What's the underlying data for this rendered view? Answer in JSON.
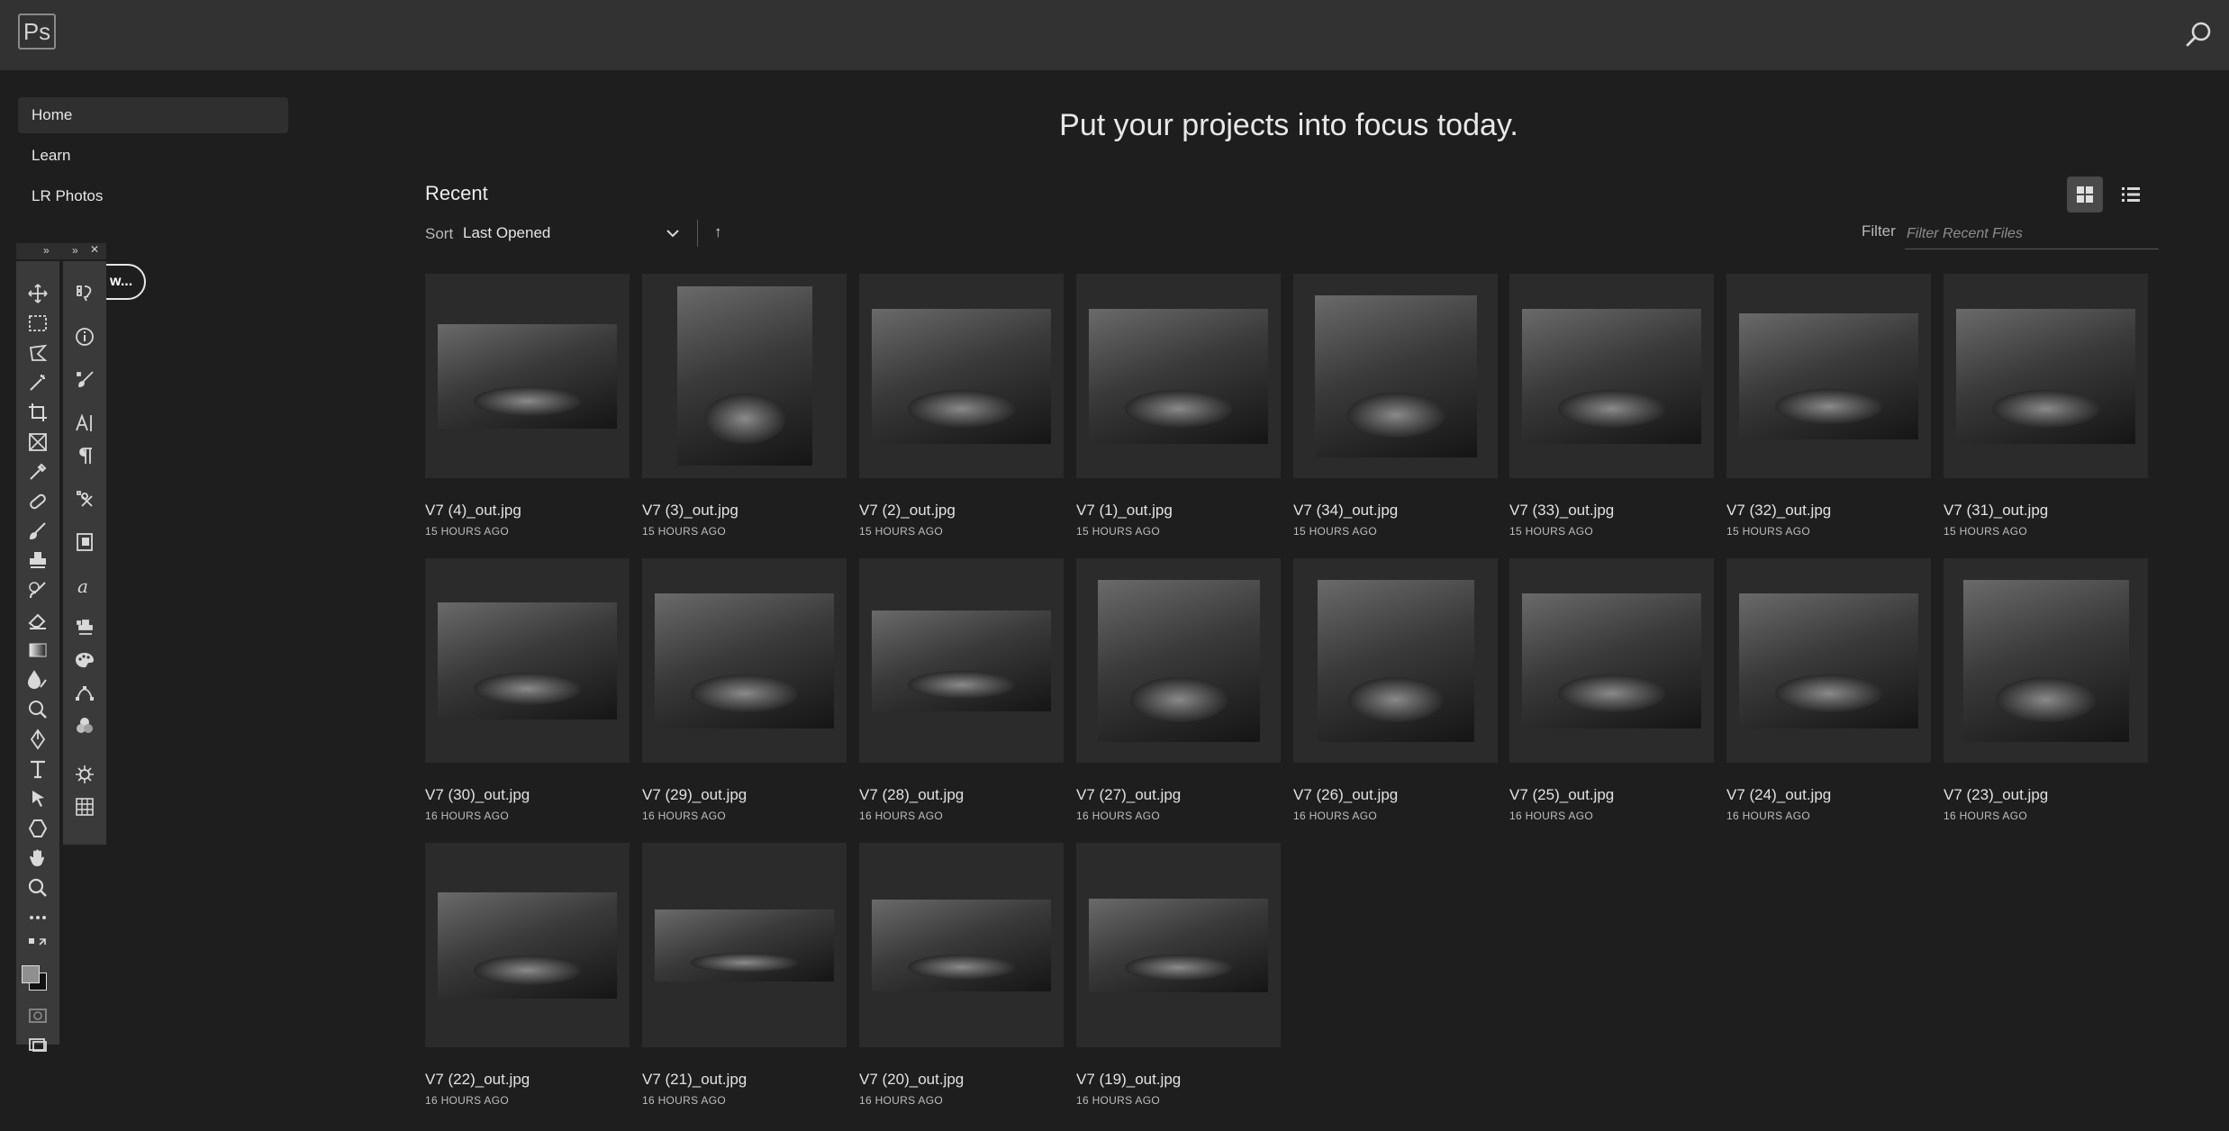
{
  "app": {
    "logo_text": "Ps"
  },
  "sidenav": {
    "items": [
      {
        "label": "Home",
        "active": true
      },
      {
        "label": "Learn",
        "active": false
      },
      {
        "label": "LR Photos",
        "active": false
      }
    ],
    "new_button_label": "w..."
  },
  "main": {
    "headline": "Put your projects into focus today.",
    "recent_title": "Recent",
    "sort": {
      "label": "Sort",
      "value": "Last Opened",
      "direction_glyph": "↑"
    },
    "filter": {
      "label": "Filter",
      "placeholder": "Filter Recent Files",
      "value": ""
    },
    "files": [
      {
        "name": "V7 (4)_out.jpg",
        "time": "15 HOURS AGO"
      },
      {
        "name": "V7 (3)_out.jpg",
        "time": "15 HOURS AGO"
      },
      {
        "name": "V7 (2)_out.jpg",
        "time": "15 HOURS AGO"
      },
      {
        "name": "V7 (1)_out.jpg",
        "time": "15 HOURS AGO"
      },
      {
        "name": "V7 (34)_out.jpg",
        "time": "15 HOURS AGO"
      },
      {
        "name": "V7 (33)_out.jpg",
        "time": "15 HOURS AGO"
      },
      {
        "name": "V7 (32)_out.jpg",
        "time": "15 HOURS AGO"
      },
      {
        "name": "V7 (31)_out.jpg",
        "time": "15 HOURS AGO"
      },
      {
        "name": "V7 (30)_out.jpg",
        "time": "16 HOURS AGO"
      },
      {
        "name": "V7 (29)_out.jpg",
        "time": "16 HOURS AGO"
      },
      {
        "name": "V7 (28)_out.jpg",
        "time": "16 HOURS AGO"
      },
      {
        "name": "V7 (27)_out.jpg",
        "time": "16 HOURS AGO"
      },
      {
        "name": "V7 (26)_out.jpg",
        "time": "16 HOURS AGO"
      },
      {
        "name": "V7 (25)_out.jpg",
        "time": "16 HOURS AGO"
      },
      {
        "name": "V7 (24)_out.jpg",
        "time": "16 HOURS AGO"
      },
      {
        "name": "V7 (23)_out.jpg",
        "time": "16 HOURS AGO"
      },
      {
        "name": "V7 (22)_out.jpg",
        "time": "16 HOURS AGO"
      },
      {
        "name": "V7 (21)_out.jpg",
        "time": "16 HOURS AGO"
      },
      {
        "name": "V7 (20)_out.jpg",
        "time": "16 HOURS AGO"
      },
      {
        "name": "V7 (19)_out.jpg",
        "time": "16 HOURS AGO"
      }
    ]
  },
  "toolbox": {
    "tools_left": [
      "move-tool-icon",
      "marquee-tool-icon",
      "lasso-tool-icon",
      "magic-wand-icon",
      "crop-tool-icon",
      "frame-tool-icon",
      "eyedropper-icon",
      "healing-brush-icon",
      "brush-tool-icon",
      "clone-stamp-icon",
      "history-brush-icon",
      "eraser-icon",
      "gradient-icon",
      "blur-tool-icon",
      "dodge-tool-icon",
      "pen-tool-icon",
      "type-tool-icon",
      "path-selection-icon",
      "shape-tool-icon",
      "hand-tool-icon",
      "zoom-tool-icon",
      "more-tools-icon"
    ],
    "panels_right": [
      "history-panel-icon",
      "info-panel-icon",
      "brushes-panel-icon",
      "character-panel-icon",
      "paragraph-panel-icon",
      "tool-presets-icon",
      "properties-panel-icon",
      "glyphs-panel-icon",
      "clone-source-icon",
      "color-panel-icon",
      "paths-panel-icon",
      "channels-panel-icon",
      "adjustments-panel-icon",
      "swatches-panel-icon"
    ]
  },
  "colors": {
    "background": "#1e1e1e",
    "topbar": "#323232",
    "card": "#2b2b2b",
    "active_nav": "#2f2f2f"
  }
}
